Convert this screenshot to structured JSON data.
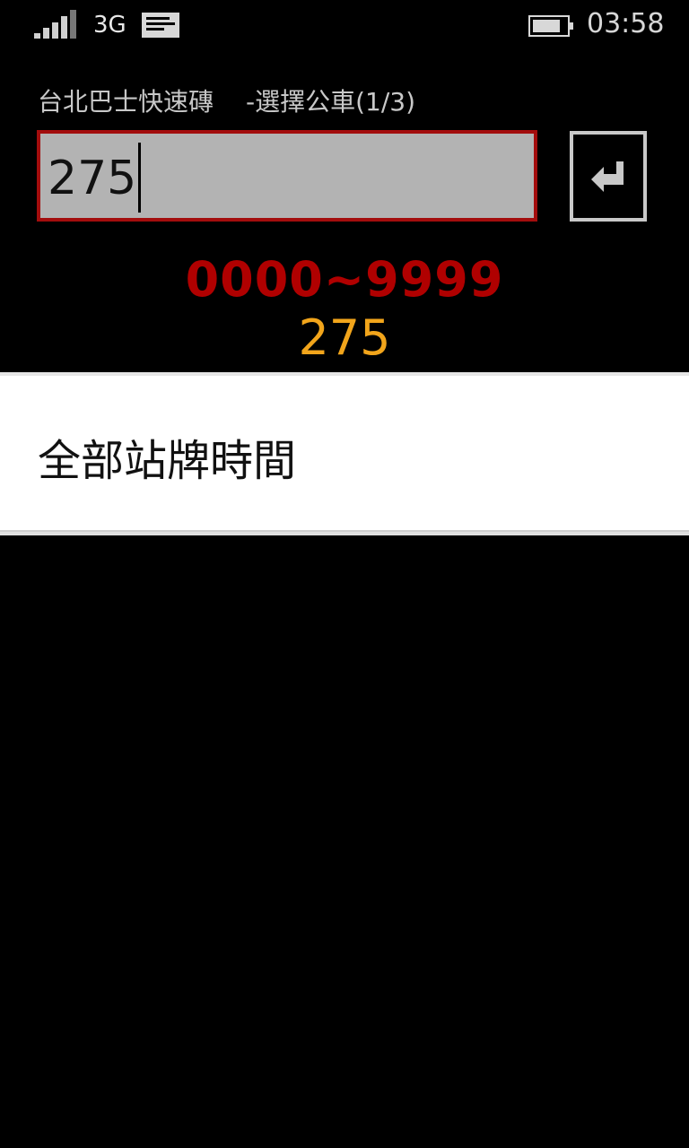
{
  "status_bar": {
    "network": "3G",
    "time": "03:58",
    "signal_icon": "signal-strength-icon",
    "message_icon": "message-icon",
    "battery_icon": "battery-icon"
  },
  "header": {
    "app_title": "台北巴士快速磚",
    "step_label": "-選擇公車(1/3)"
  },
  "route_input": {
    "value": "275",
    "accent_color": "#a30d0d"
  },
  "enter_button": {
    "icon": "enter-return-icon"
  },
  "range_hint": "0000~9999",
  "selected_route": "275",
  "list": {
    "items": [
      {
        "label": "全部站牌時間"
      }
    ]
  },
  "colors": {
    "range": "#b00000",
    "value": "#f2a51b",
    "background": "#000000"
  }
}
